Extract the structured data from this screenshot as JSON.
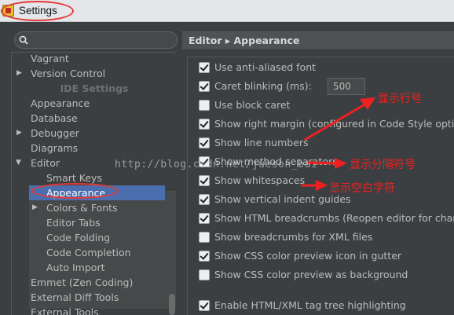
{
  "window": {
    "title": "Settings"
  },
  "search": {
    "placeholder": "",
    "value": ""
  },
  "tree": {
    "items_top": [
      {
        "label": "Vagrant"
      },
      {
        "label": "Version Control"
      }
    ],
    "ide_section": "IDE Settings",
    "ide_items": [
      {
        "label": "Appearance"
      },
      {
        "label": "Database"
      },
      {
        "label": "Debugger"
      },
      {
        "label": "Diagrams"
      },
      {
        "label": "Editor"
      }
    ],
    "editor_children": [
      {
        "label": "Smart Keys"
      },
      {
        "label": "Appearance"
      },
      {
        "label": "Colors & Fonts"
      },
      {
        "label": "Editor Tabs"
      },
      {
        "label": "Code Folding"
      },
      {
        "label": "Code Completion"
      },
      {
        "label": "Auto Import"
      }
    ],
    "items_bottom": [
      {
        "label": "Emmet (Zen Coding)"
      },
      {
        "label": "External Diff Tools"
      },
      {
        "label": "External Tools"
      }
    ]
  },
  "breadcrumb": {
    "parent": "Editor",
    "separator": "▸",
    "current": "Appearance"
  },
  "options": [
    {
      "label": "Use anti-aliased font",
      "checked": true
    },
    {
      "label": "Caret blinking (ms):",
      "checked": true,
      "value": "500"
    },
    {
      "label": "Use block caret",
      "checked": false
    },
    {
      "label": "Show right margin (configured in Code Style options)",
      "checked": true
    },
    {
      "label": "Show line numbers",
      "checked": true
    },
    {
      "label": "Show method separators",
      "checked": true
    },
    {
      "label": "Show whitespaces",
      "checked": true
    },
    {
      "label": "Show vertical indent guides",
      "checked": true
    },
    {
      "label": "Show HTML breadcrumbs (Reopen editor for changes to take effect)",
      "checked": true
    },
    {
      "label": "Show breadcrumbs for XML files",
      "checked": false
    },
    {
      "label": "Show CSS color preview icon in gutter",
      "checked": true
    },
    {
      "label": "Show CSS color preview as background",
      "checked": false
    },
    {
      "label": "Enable HTML/XML tag tree highlighting",
      "checked": true
    }
  ],
  "annotations": {
    "line_numbers": "显示行号",
    "method_separators": "显示分隔符号",
    "whitespaces": "显示空白字符",
    "watermark": "http://blog.csdn.net/jueson_bai"
  },
  "colors": {
    "background": "#3c3f41",
    "selection": "#4b6eaf",
    "annotation_red": "#f02020"
  }
}
